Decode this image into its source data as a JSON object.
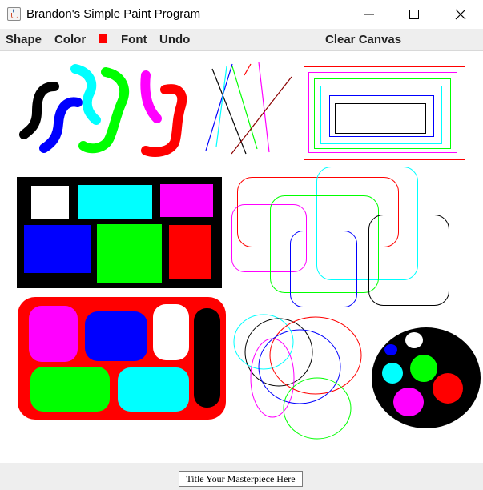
{
  "window": {
    "title": "Brandon's Simple Paint Program",
    "icon": "java-cup-icon"
  },
  "menu": {
    "shape_label": "Shape",
    "color_label": "Color",
    "current_color": "#ff0000",
    "font_label": "Font",
    "undo_label": "Undo",
    "clear_label": "Clear Canvas"
  },
  "canvas": {
    "background": "#ffffff",
    "palette": [
      "#000000",
      "#0000ff",
      "#00ffff",
      "#00ff00",
      "#ff00ff",
      "#ff0000",
      "#ffffff",
      "#8b0000"
    ]
  },
  "footer": {
    "title_value": "Title Your Masterpiece Here"
  }
}
